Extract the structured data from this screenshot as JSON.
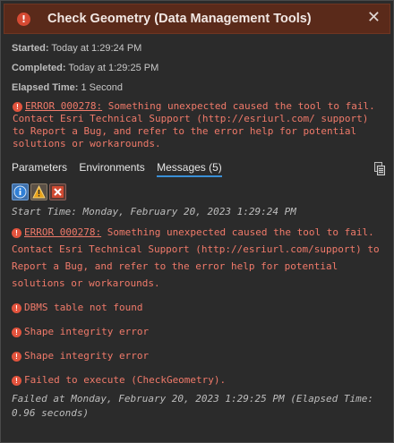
{
  "window": {
    "title": "Check Geometry (Data Management Tools)"
  },
  "summary": {
    "started_label": "Started:",
    "started_value": "Today at 1:29:24 PM",
    "completed_label": "Completed:",
    "completed_value": "Today at 1:29:25 PM",
    "elapsed_label": "Elapsed Time:",
    "elapsed_value": "1 Second"
  },
  "top_error": {
    "code": "ERROR 000278:",
    "text": " Something unexpected caused the tool to fail. Contact Esri Technical Support (http://esriurl.com/ support) to Report a Bug, and refer to the error help for potential solutions or workarounds."
  },
  "tabs": [
    {
      "label": "Parameters"
    },
    {
      "label": "Environments"
    },
    {
      "label": "Messages (5)"
    }
  ],
  "messages": {
    "start_time": "Start Time: Monday, February 20, 2023 1:29:24 PM",
    "error_code": "ERROR 000278:",
    "error_text": " Something unexpected caused the tool to fail. Contact Esri Technical Support (http://esriurl.com/support) to Report a Bug, and refer to the error help for potential solutions or workarounds.",
    "items": [
      "DBMS table not found",
      "Shape integrity error",
      "Shape integrity error",
      "Failed to execute (CheckGeometry)."
    ],
    "failed_at": "Failed at Monday, February 20, 2023 1:29:25 PM (Elapsed Time: 0.96 seconds)"
  },
  "colors": {
    "title_bar": "#5a2a1a",
    "error_text": "#f07a6a",
    "accent": "#3a8fd6"
  }
}
